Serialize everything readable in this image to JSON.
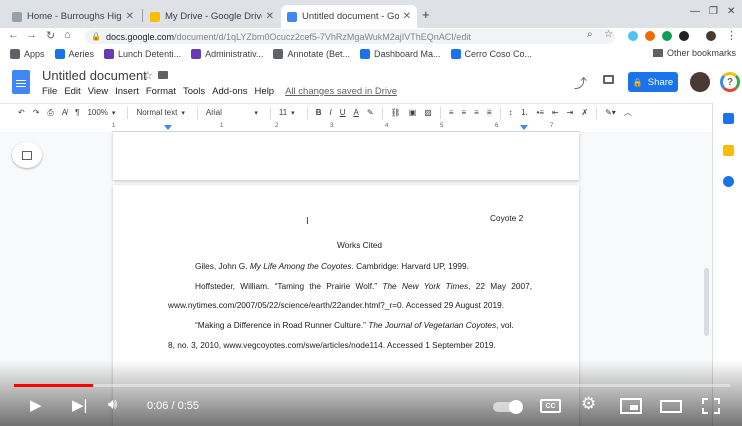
{
  "browser": {
    "tabs": [
      {
        "title": "Home - Burroughs High S",
        "active": false,
        "color": "#9aa0a6"
      },
      {
        "title": "My Drive - Google Drive",
        "active": false,
        "color": "#fbbc04"
      },
      {
        "title": "Untitled document - Goo",
        "active": true,
        "color": "#4285f4"
      }
    ],
    "url_host": "docs.google.com",
    "url_path": "/document/d/1qLYZbm0Ocucz2cef5-7VhRzMgaWukM2ajIVThEQnACI/edit",
    "bookmarks": [
      {
        "label": "Apps",
        "color": "#5f6368"
      },
      {
        "label": "Aeries",
        "color": "#1a73e8"
      },
      {
        "label": "Lunch Detenti...",
        "color": "#673ab7"
      },
      {
        "label": "Administrativ...",
        "color": "#673ab7"
      },
      {
        "label": "Annotate (Bet...",
        "color": "#5f6368"
      },
      {
        "label": "Dashboard Ma...",
        "color": "#1a73e8"
      },
      {
        "label": "Cerro Coso Co...",
        "color": "#1a73e8"
      }
    ],
    "other_bookmarks": "Other bookmarks"
  },
  "docs": {
    "title": "Untitled document",
    "menu": [
      "File",
      "Edit",
      "View",
      "Insert",
      "Format",
      "Tools",
      "Add-ons",
      "Help"
    ],
    "save_status": "All changes saved in Drive",
    "share_label": "Share",
    "toolbar": {
      "zoom": "100%",
      "style": "Normal text",
      "font": "Arial",
      "size": "11"
    },
    "ruler_numbers": [
      "1",
      "1",
      "2",
      "3",
      "4",
      "5",
      "6",
      "7"
    ]
  },
  "document": {
    "page_header": "Coyote 2",
    "heading": "Works Cited",
    "entries": [
      {
        "parts": [
          [
            "Giles, John G. ",
            false
          ],
          [
            "My Life Among the Coyotes",
            true
          ],
          [
            ".  Cambridge: Harvard UP, 1999.",
            false
          ]
        ],
        "line2": ""
      },
      {
        "parts": [
          [
            "Hoffsteder, William. “Taming the Prairie Wolf.” ",
            false
          ],
          [
            "The New York Times",
            true
          ],
          [
            ", 22 May 2007,",
            false
          ]
        ],
        "line2": "www.nytimes.com/2007/05/22/science/earth/22ander.html?_r=0. Accessed 29 August  2019."
      },
      {
        "parts": [
          [
            "“Making a Difference in Road Runner Culture.” ",
            false
          ],
          [
            "The Journal of Vegetarian Coyotes",
            true
          ],
          [
            ", vol.",
            false
          ]
        ],
        "line2": "8, no. 3, 2010, www.vegcoyotes.com/swe/articles/node114. Accessed 1 September 2019."
      }
    ]
  },
  "player": {
    "current_time": "0:06",
    "duration": "0:55",
    "time_sep": " / ",
    "progress_fraction": 0.11,
    "cc_label": "CC",
    "accent": "#ff0000"
  }
}
